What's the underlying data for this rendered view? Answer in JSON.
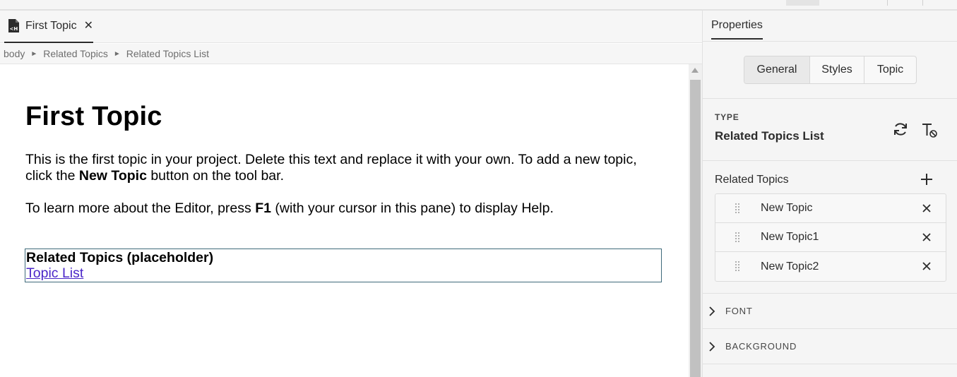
{
  "editor": {
    "tab": {
      "label": "First Topic",
      "icon": "html-file-icon",
      "close": "✕"
    },
    "breadcrumb": [
      "body",
      "Related Topics",
      "Related Topics List"
    ],
    "breadcrumb_separator": "►",
    "content": {
      "heading": "First Topic",
      "p1_before": "This is the first topic in your project. Delete this text and replace it with your own. To add a new topic, click the ",
      "p1_bold": "New Topic",
      "p1_after": " button on the tool bar.",
      "p2_before": "To learn more about the Editor, press ",
      "p2_bold": "F1",
      "p2_after": " (with your cursor in this pane) to display Help.",
      "related_heading": "Related Topics (placeholder)",
      "related_link": "Topic List"
    }
  },
  "properties": {
    "title": "Properties",
    "tabs": [
      "General",
      "Styles",
      "Topic"
    ],
    "active_tab": "General",
    "type_label": "TYPE",
    "type_value": "Related Topics List",
    "related_topics_title": "Related Topics",
    "related_topics": [
      "New Topic",
      "New Topic1",
      "New Topic2"
    ],
    "remove_glyph": "✕",
    "sections": [
      "FONT",
      "BACKGROUND"
    ]
  }
}
